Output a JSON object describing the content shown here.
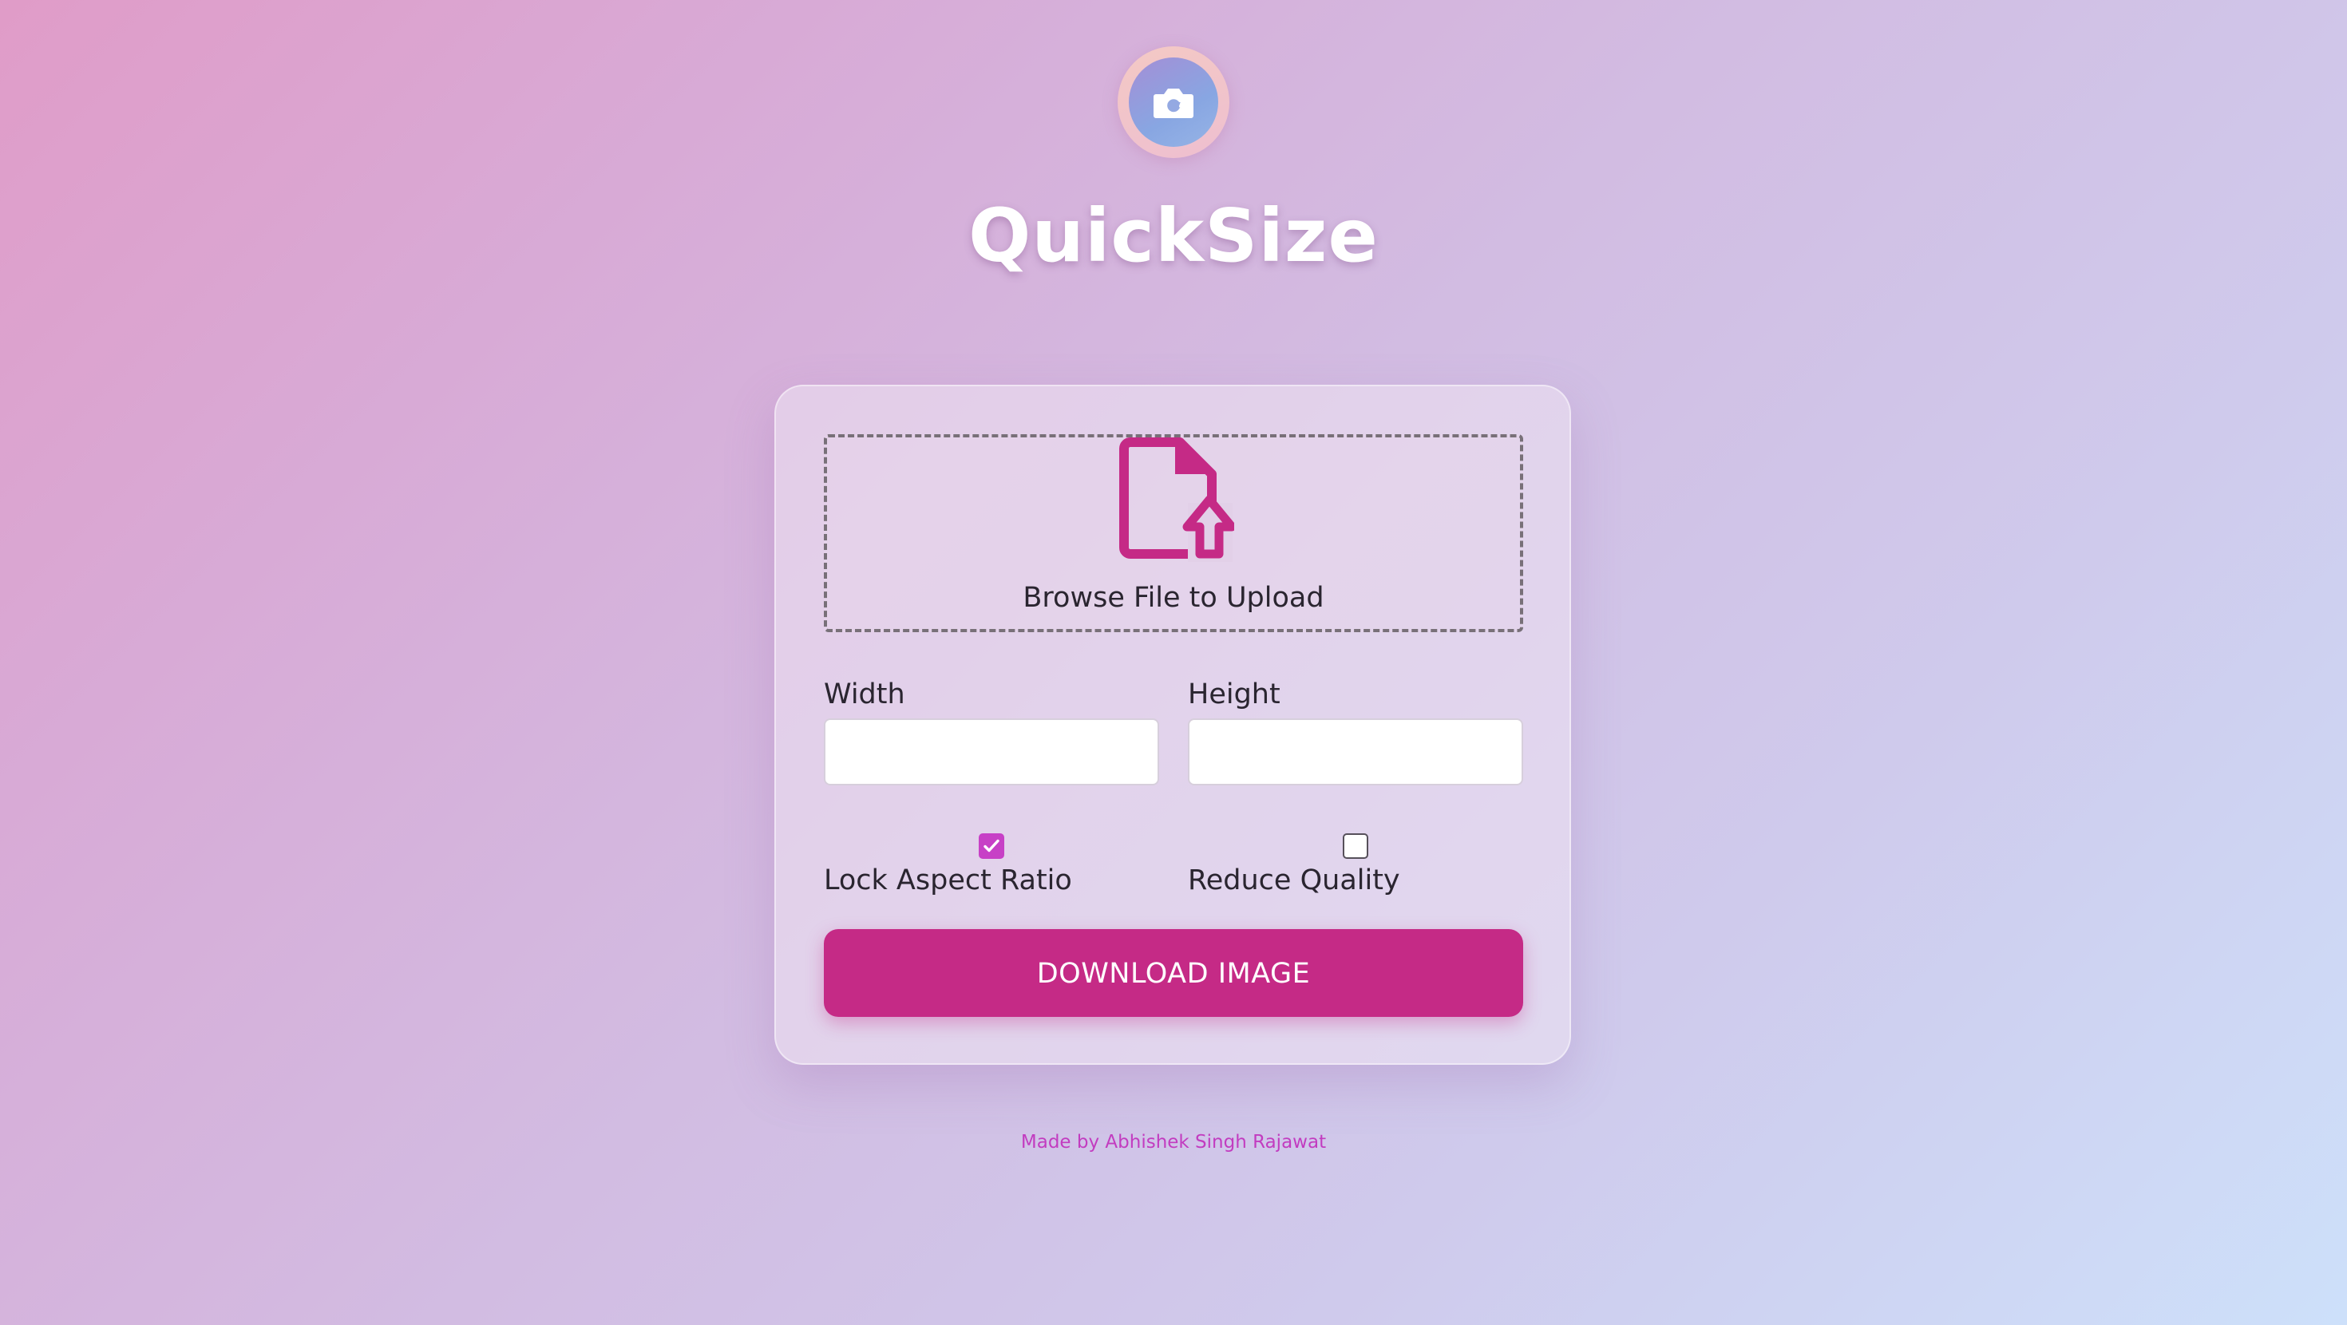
{
  "app": {
    "title": "QuickSize",
    "logo_icon": "camera-rotate-icon"
  },
  "upload": {
    "icon": "file-upload-icon",
    "label": "Browse File to Upload"
  },
  "fields": {
    "width_label": "Width",
    "width_value": "",
    "height_label": "Height",
    "height_value": ""
  },
  "options": {
    "lock_aspect_label": "Lock Aspect Ratio",
    "lock_aspect_checked": true,
    "reduce_quality_label": "Reduce Quality",
    "reduce_quality_checked": false
  },
  "actions": {
    "download_label": "DOWNLOAD IMAGE"
  },
  "footer": {
    "credit": "Made by Abhishek Singh Rajawat"
  },
  "colors": {
    "accent": "#c52a86",
    "checkbox_accent": "#c740c6",
    "footer_text": "#c23cc0"
  }
}
